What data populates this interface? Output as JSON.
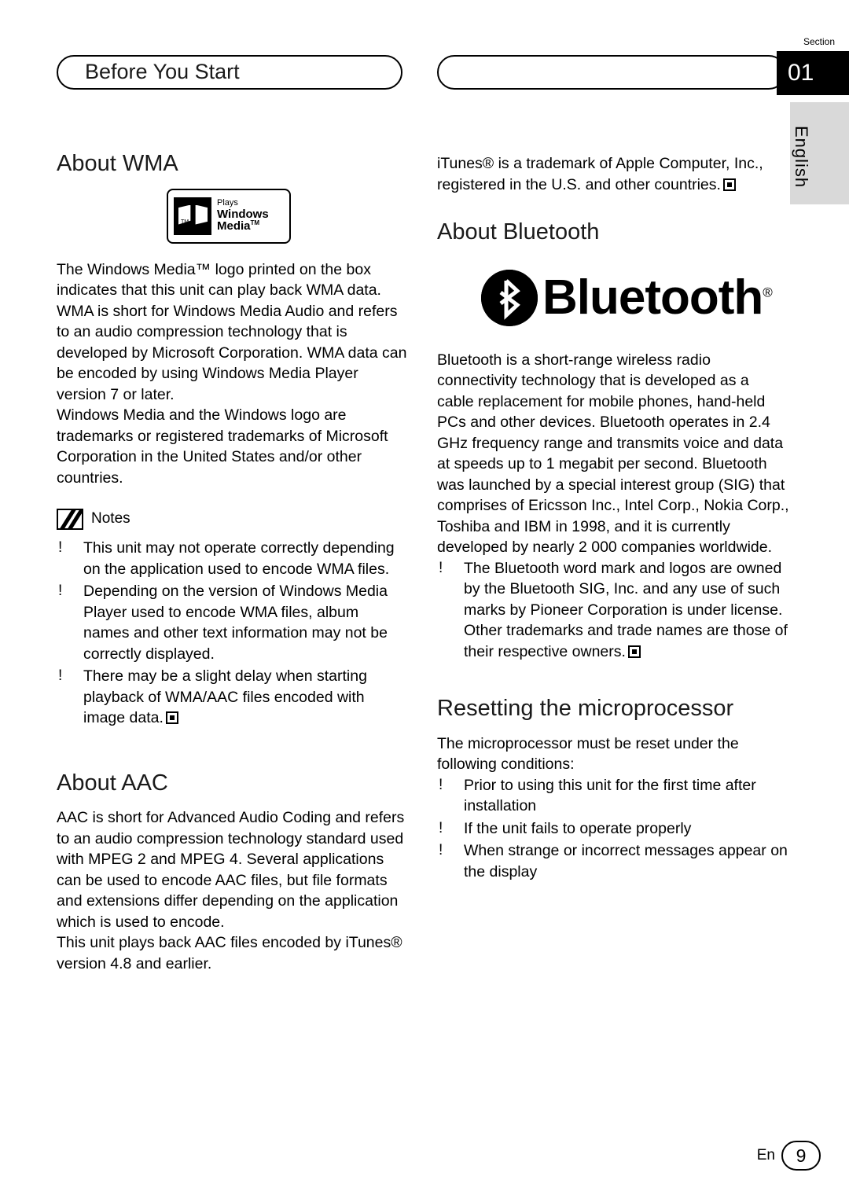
{
  "header": {
    "chapter_title": "Before You Start",
    "section_label": "Section",
    "section_number": "01",
    "language_tab": "English"
  },
  "left_column": {
    "wma": {
      "heading": "About WMA",
      "logo": {
        "plays": "Plays",
        "windows": "Windows",
        "media": "Media",
        "media_tm": "TM",
        "flag_tm": "TM"
      },
      "paragraphs": [
        "The Windows Media™ logo printed on the box indicates that this unit can play back WMA data.",
        "WMA is short for Windows Media Audio and refers to an audio compression technology that is developed by Microsoft Corporation. WMA data can be encoded by using Windows Media Player version 7 or later.",
        "Windows Media and the Windows logo are trademarks or registered trademarks of Microsoft Corporation in the United States and/or other countries."
      ],
      "notes_label": "Notes",
      "notes": [
        "This unit may not operate correctly depending on the application used to encode WMA files.",
        "Depending on the version of Windows Media Player used to encode WMA files, album names and other text information may not be correctly displayed.",
        "There may be a slight delay when starting playback of WMA/AAC files encoded with image data."
      ]
    },
    "aac": {
      "heading": "About AAC",
      "paragraphs": [
        "AAC is short for Advanced Audio Coding and refers to an audio compression technology standard used with MPEG 2 and MPEG 4. Several applications can be used to encode AAC files, but file formats and extensions differ depending on the application which is used to encode.",
        "This unit plays back AAC files encoded by iTunes® version 4.8 and earlier."
      ]
    }
  },
  "right_column": {
    "itunes_note": "iTunes® is a trademark of Apple Computer, Inc., registered in the U.S. and other countries.",
    "bluetooth": {
      "heading": "About Bluetooth",
      "logo_word": "Bluetooth",
      "logo_reg": "®",
      "paragraph": "Bluetooth is a short-range wireless radio connectivity technology that is developed as a cable replacement for mobile phones, hand-held PCs and other devices. Bluetooth operates in 2.4 GHz frequency range and transmits voice and data at speeds up to 1 megabit per second. Bluetooth was launched by a special interest group (SIG) that comprises of Ericsson Inc., Intel Corp., Nokia Corp., Toshiba and IBM in 1998, and it is currently developed by nearly 2 000 companies worldwide.",
      "notes": [
        "The Bluetooth word mark and logos are owned by the Bluetooth SIG, Inc. and any use of such marks by Pioneer Corporation is under license. Other trademarks and trade names are those of their respective owners."
      ]
    },
    "reset": {
      "heading": "Resetting the microprocessor",
      "intro": "The microprocessor must be reset under the following conditions:",
      "conditions": [
        "Prior to using this unit for the first time after installation",
        "If the unit fails to operate properly",
        "When strange or incorrect messages appear on the display"
      ]
    }
  },
  "footer": {
    "lang_code": "En",
    "page_number": "9"
  },
  "bullet_glyph": "!"
}
